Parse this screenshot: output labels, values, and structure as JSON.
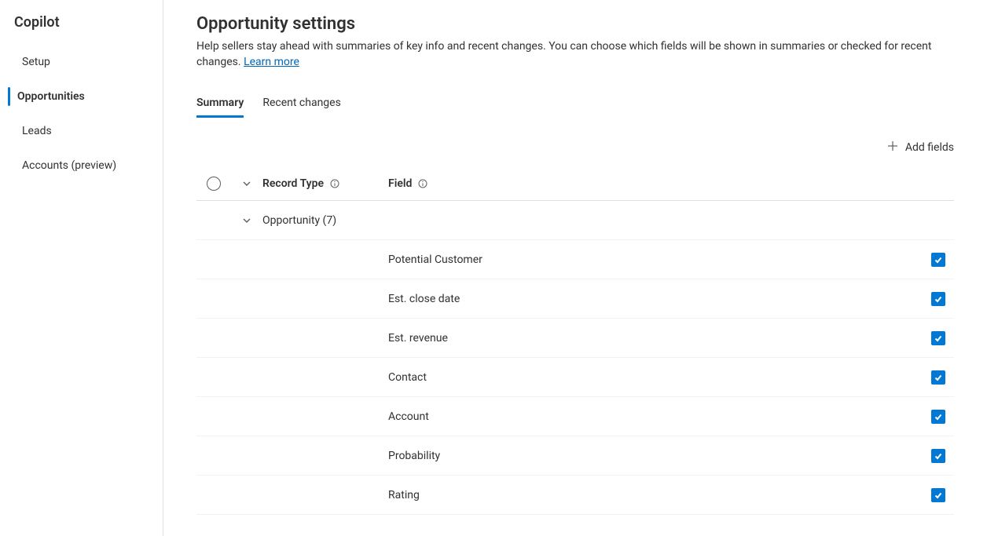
{
  "sidebar": {
    "title": "Copilot",
    "items": [
      {
        "label": "Setup"
      },
      {
        "label": "Opportunities"
      },
      {
        "label": "Leads"
      },
      {
        "label": "Accounts (preview)"
      }
    ]
  },
  "header": {
    "title": "Opportunity settings",
    "description_prefix": "Help sellers stay ahead with summaries of key info and recent changes. You can choose which fields will be shown in summaries or checked for recent changes. ",
    "learn_more": "Learn more"
  },
  "tabs": [
    {
      "label": "Summary"
    },
    {
      "label": "Recent changes"
    }
  ],
  "toolbar": {
    "add_fields": "Add fields"
  },
  "table": {
    "columns": {
      "record_type": "Record Type",
      "field": "Field"
    },
    "group": {
      "label": "Opportunity (7)"
    },
    "rows": [
      {
        "field": "Potential Customer",
        "checked": true
      },
      {
        "field": "Est. close date",
        "checked": true
      },
      {
        "field": "Est. revenue",
        "checked": true
      },
      {
        "field": "Contact",
        "checked": true
      },
      {
        "field": "Account",
        "checked": true
      },
      {
        "field": "Probability",
        "checked": true
      },
      {
        "field": "Rating",
        "checked": true
      }
    ]
  }
}
